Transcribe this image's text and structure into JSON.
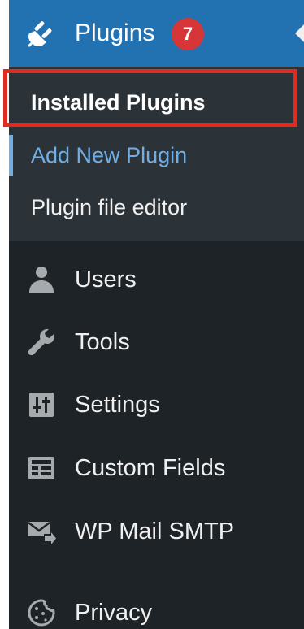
{
  "menu": {
    "active": {
      "label": "Plugins",
      "badge": "7",
      "icon": "plugin-icon"
    },
    "submenu": [
      {
        "label": "Installed Plugins",
        "state": "current"
      },
      {
        "label": "Add New Plugin",
        "state": "hover"
      },
      {
        "label": "Plugin file editor",
        "state": "default"
      }
    ],
    "items": [
      {
        "label": "Users",
        "icon": "user-icon"
      },
      {
        "label": "Tools",
        "icon": "wrench-icon"
      },
      {
        "label": "Settings",
        "icon": "settings-icon"
      },
      {
        "label": "Custom Fields",
        "icon": "custom-fields-icon"
      },
      {
        "label": "WP Mail SMTP",
        "icon": "mail-icon"
      },
      {
        "label": "Privacy",
        "icon": "cookie-icon"
      }
    ]
  },
  "colors": {
    "sidebar_bg": "#1d2327",
    "submenu_bg": "#2c3338",
    "active_bg": "#2271b1",
    "badge_bg": "#d63638",
    "hover_text": "#72aee6",
    "highlight_border": "#e02b20"
  }
}
